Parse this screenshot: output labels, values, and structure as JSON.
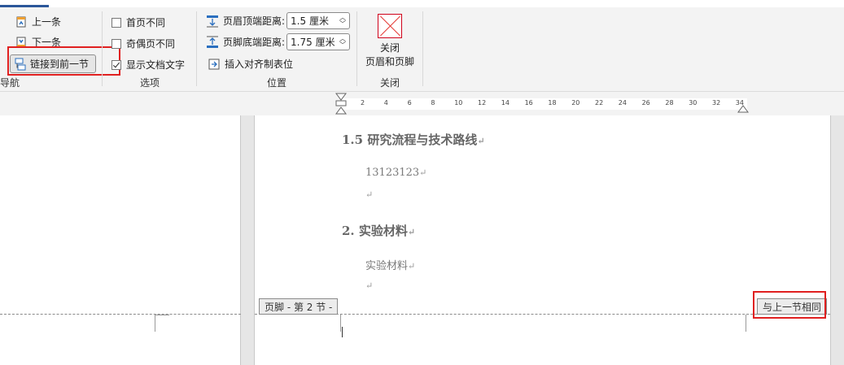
{
  "ribbon": {
    "tab_fragment": "页眉和页脚",
    "navigation": {
      "prev_label": "上一条",
      "next_label": "下一条",
      "link_prev_label": "链接到前一节",
      "group_label": "导航"
    },
    "options": {
      "different_first_page": "首页不同",
      "different_odd_even": "奇偶页不同",
      "show_doc_text": "显示文档文字",
      "show_doc_text_checked": true,
      "group_label": "选项"
    },
    "position": {
      "header_top_label": "页眉顶端距离:",
      "header_top_value": "1.5 厘米",
      "footer_bottom_label": "页脚底端距离:",
      "footer_bottom_value": "1.75 厘米",
      "insert_tab_label": "插入对齐制表位",
      "group_label": "位置"
    },
    "close": {
      "label_line1": "关闭",
      "label_line2": "页眉和页脚",
      "group_label": "关闭"
    }
  },
  "ruler": {
    "ticks": [
      "2",
      "4",
      "6",
      "8",
      "10",
      "12",
      "14",
      "16",
      "18",
      "20",
      "22",
      "24",
      "26",
      "28",
      "30",
      "32",
      "34"
    ]
  },
  "document": {
    "heading1": "1.5   研究流程与技术路线",
    "para1": "13123123",
    "heading2": "2.   实验材料",
    "para2": "实验材料",
    "return_mark": "↵"
  },
  "footer": {
    "tag": "页脚 - 第 2 节 -",
    "same_as_previous": "与上一节相同"
  }
}
